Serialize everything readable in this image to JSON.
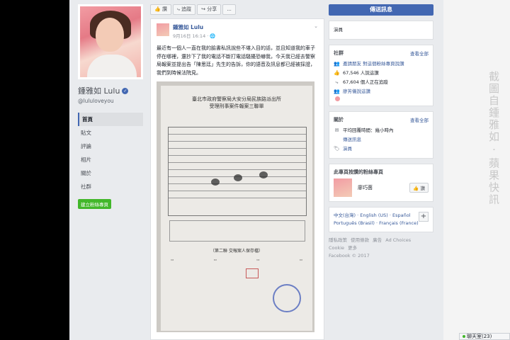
{
  "page": {
    "name": "鍾雅如 Lulu",
    "handle": "@lululoveyou",
    "nav": [
      "首頁",
      "貼文",
      "評論",
      "相片",
      "關於",
      "社群"
    ],
    "create_page": "建立粉絲專頁"
  },
  "actions": {
    "like": "讚",
    "follow": "追蹤",
    "share": "分享",
    "more": "..."
  },
  "post": {
    "author": "鍾雅如 Lulu",
    "time": "9月16日 16:14 · 🌐",
    "text": "最近有一個人一直在我的臉書私訊說些不堪入目的話，並且知道我的車子停在哪裡，還抄下了我的電話不斷打電話騷擾恐嚇我，今天我已經去警察局報案並提出告「陳思廷」先生的告訴，你的語音及訊息都已經被採證，我們到時候法院見。",
    "document": {
      "title": "臺北市政府警察局大安分局民族路派出所",
      "subtitle": "受理刑事案件報案三聯單",
      "part": "（第二聯 交報案人保存檔）"
    }
  },
  "sidebar": {
    "message_button": "傳送訊息",
    "category": "演員",
    "community": {
      "title": "社群",
      "see_all": "查看全部",
      "invite": "邀請朋友 對這個粉絲專頁說讚",
      "likes": "67,546 人說這讚",
      "follows": "67,604 個人正在追蹤",
      "friends": "廖芳儀說這讚"
    },
    "about": {
      "title": "關於",
      "see_all": "查看全部",
      "response": "平均回覆時間：幾小時內",
      "send_message": "傳送訊息",
      "category": "演員"
    },
    "liked_pages": {
      "title": "此專頁按讚的粉絲專頁",
      "name": "廖巧茵",
      "like_button": "讚"
    },
    "languages": [
      "中文(台灣)",
      "English (US)",
      "Español",
      "Português (Brasil)",
      "Français (France)"
    ],
    "footer": {
      "links": [
        "隱私政策",
        "使用條款",
        "廣告",
        "Ad Choices",
        "Cookie",
        "更多"
      ],
      "copyright": "Facebook © 2017"
    }
  },
  "overlay": {
    "watermark": "截圖自鍾雅如 · 蘋果快訊",
    "chat": "聊天室(23)"
  }
}
